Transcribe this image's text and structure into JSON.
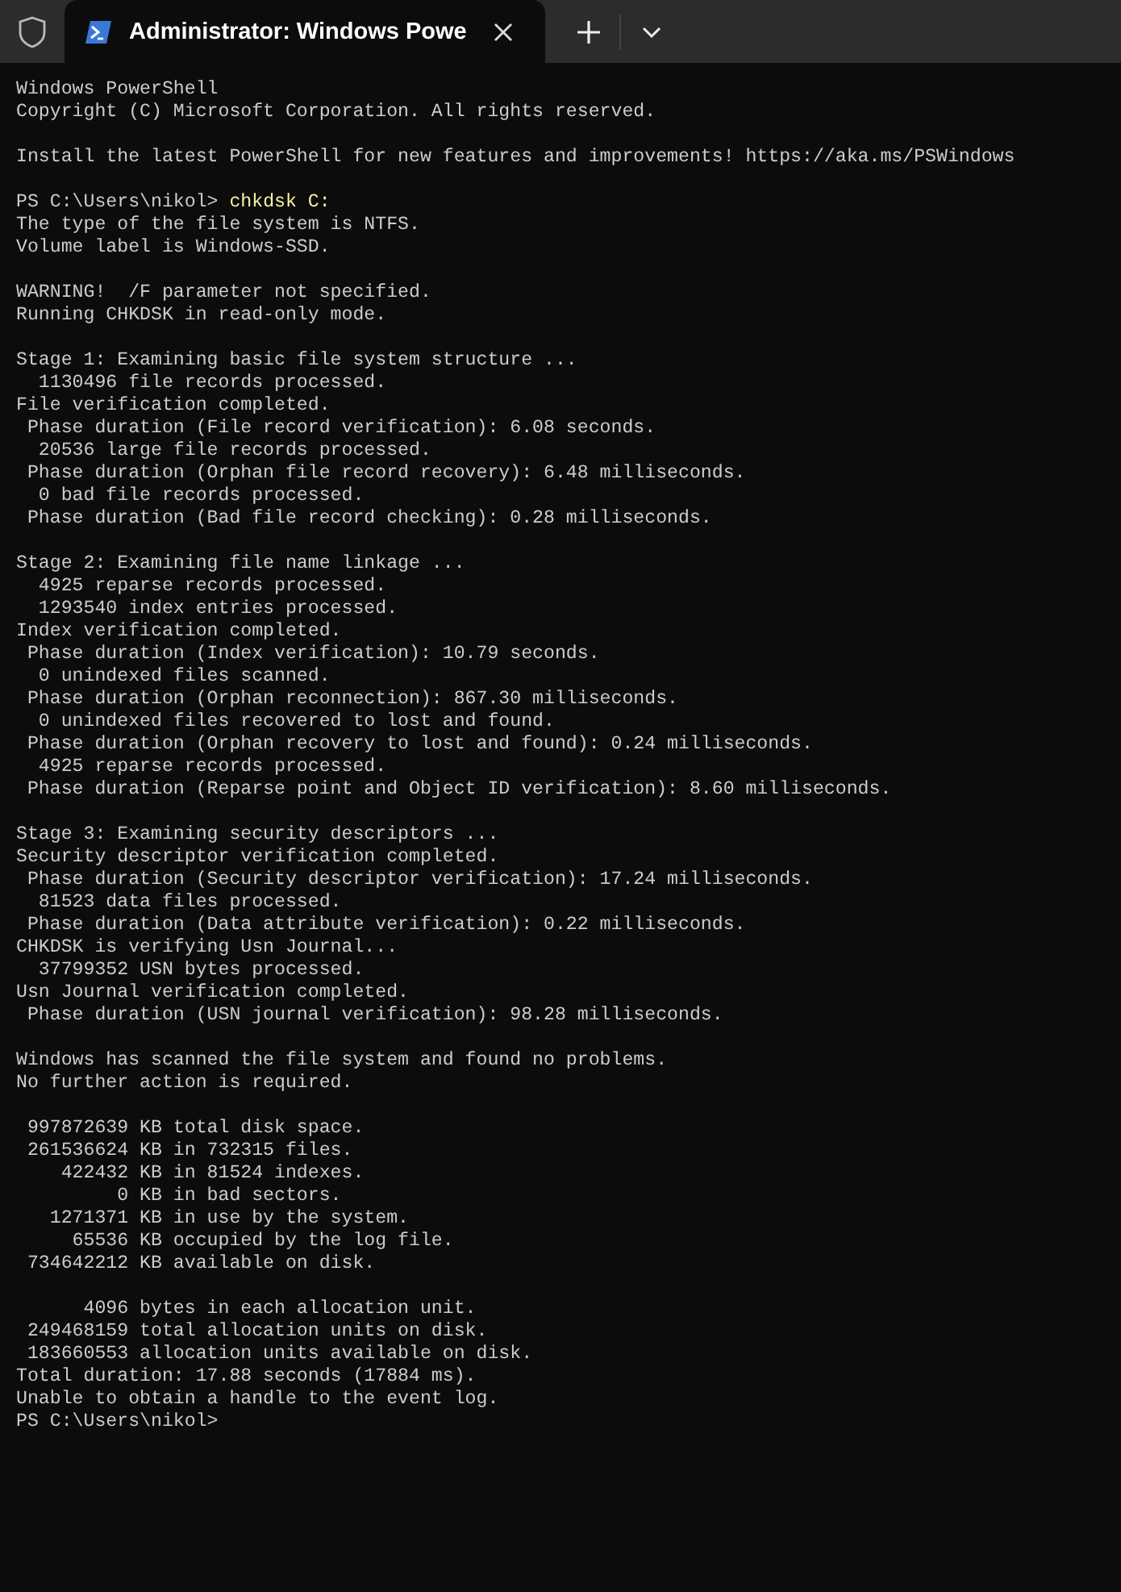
{
  "tabs": [
    {
      "title": "Administrator: Windows Powe",
      "selected": true
    }
  ],
  "blocks": [
    [
      {
        "kind": "output",
        "text": "Windows PowerShell"
      },
      {
        "kind": "output",
        "text": "Copyright (C) Microsoft Corporation. All rights reserved."
      }
    ],
    [
      {
        "kind": "output",
        "text": "Install the latest PowerShell for new features and improvements! https://aka.ms/PSWindows"
      }
    ],
    [
      {
        "kind": "prompt",
        "prompt": "PS C:\\Users\\nikol>",
        "command": "chkdsk C:"
      },
      {
        "kind": "output",
        "text": "The type of the file system is NTFS."
      },
      {
        "kind": "output",
        "text": "Volume label is Windows-SSD."
      }
    ],
    [
      {
        "kind": "output",
        "text": "WARNING!  /F parameter not specified."
      },
      {
        "kind": "output",
        "text": "Running CHKDSK in read-only mode."
      }
    ],
    [
      {
        "kind": "output",
        "text": "Stage 1: Examining basic file system structure ..."
      },
      {
        "kind": "output",
        "text": "  1130496 file records processed."
      },
      {
        "kind": "output",
        "text": "File verification completed."
      },
      {
        "kind": "output",
        "text": " Phase duration (File record verification): 6.08 seconds."
      },
      {
        "kind": "output",
        "text": "  20536 large file records processed."
      },
      {
        "kind": "output",
        "text": " Phase duration (Orphan file record recovery): 6.48 milliseconds."
      },
      {
        "kind": "output",
        "text": "  0 bad file records processed."
      },
      {
        "kind": "output",
        "text": " Phase duration (Bad file record checking): 0.28 milliseconds."
      }
    ],
    [
      {
        "kind": "output",
        "text": "Stage 2: Examining file name linkage ..."
      },
      {
        "kind": "output",
        "text": "  4925 reparse records processed."
      },
      {
        "kind": "output",
        "text": "  1293540 index entries processed."
      },
      {
        "kind": "output",
        "text": "Index verification completed."
      },
      {
        "kind": "output",
        "text": " Phase duration (Index verification): 10.79 seconds."
      },
      {
        "kind": "output",
        "text": "  0 unindexed files scanned."
      },
      {
        "kind": "output",
        "text": " Phase duration (Orphan reconnection): 867.30 milliseconds."
      },
      {
        "kind": "output",
        "text": "  0 unindexed files recovered to lost and found."
      },
      {
        "kind": "output",
        "text": " Phase duration (Orphan recovery to lost and found): 0.24 milliseconds."
      },
      {
        "kind": "output",
        "text": "  4925 reparse records processed."
      },
      {
        "kind": "output",
        "text": " Phase duration (Reparse point and Object ID verification): 8.60 milliseconds."
      }
    ],
    [
      {
        "kind": "output",
        "text": "Stage 3: Examining security descriptors ..."
      },
      {
        "kind": "output",
        "text": "Security descriptor verification completed."
      },
      {
        "kind": "output",
        "text": " Phase duration (Security descriptor verification): 17.24 milliseconds."
      },
      {
        "kind": "output",
        "text": "  81523 data files processed."
      },
      {
        "kind": "output",
        "text": " Phase duration (Data attribute verification): 0.22 milliseconds."
      },
      {
        "kind": "output",
        "text": "CHKDSK is verifying Usn Journal..."
      },
      {
        "kind": "output",
        "text": "  37799352 USN bytes processed."
      },
      {
        "kind": "output",
        "text": "Usn Journal verification completed."
      },
      {
        "kind": "output",
        "text": " Phase duration (USN journal verification): 98.28 milliseconds."
      }
    ],
    [
      {
        "kind": "output",
        "text": "Windows has scanned the file system and found no problems."
      },
      {
        "kind": "output",
        "text": "No further action is required."
      }
    ],
    [
      {
        "kind": "output",
        "text": " 997872639 KB total disk space."
      },
      {
        "kind": "output",
        "text": " 261536624 KB in 732315 files."
      },
      {
        "kind": "output",
        "text": "    422432 KB in 81524 indexes."
      },
      {
        "kind": "output",
        "text": "         0 KB in bad sectors."
      },
      {
        "kind": "output",
        "text": "   1271371 KB in use by the system."
      },
      {
        "kind": "output",
        "text": "     65536 KB occupied by the log file."
      },
      {
        "kind": "output",
        "text": " 734642212 KB available on disk."
      }
    ],
    [
      {
        "kind": "output",
        "text": "      4096 bytes in each allocation unit."
      },
      {
        "kind": "output",
        "text": " 249468159 total allocation units on disk."
      },
      {
        "kind": "output",
        "text": " 183660553 allocation units available on disk."
      },
      {
        "kind": "output",
        "text": "Total duration: 17.88 seconds (17884 ms)."
      },
      {
        "kind": "output",
        "text": "Unable to obtain a handle to the event log."
      },
      {
        "kind": "prompt",
        "prompt": "PS C:\\Users\\nikol>"
      }
    ]
  ]
}
